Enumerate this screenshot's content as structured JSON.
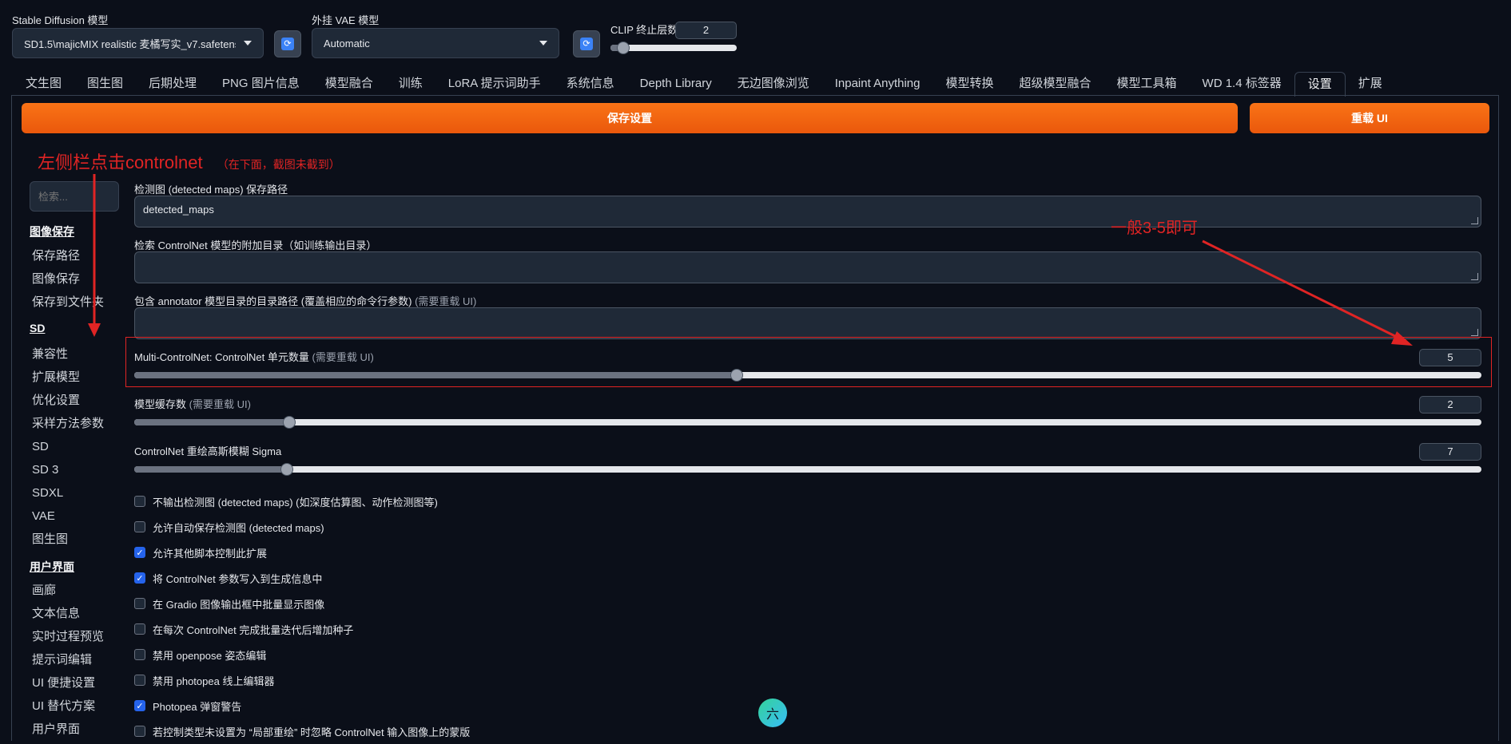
{
  "header": {
    "sd_model_label": "Stable Diffusion 模型",
    "sd_model_value": "SD1.5\\majicMIX realistic 麦橘写实_v7.safetensors",
    "vae_label": "外挂 VAE 模型",
    "vae_value": "Automatic",
    "clip_label": "CLIP 终止层数",
    "clip_value": "2",
    "clip_slider_fraction": 0.1
  },
  "tabs": [
    "文生图",
    "图生图",
    "后期处理",
    "PNG 图片信息",
    "模型融合",
    "训练",
    "LoRA 提示词助手",
    "系统信息",
    "Depth Library",
    "无边图像浏览",
    "Inpaint Anything",
    "模型转换",
    "超级模型融合",
    "模型工具箱",
    "WD 1.4 标签器",
    "设置",
    "扩展"
  ],
  "active_tab": "设置",
  "actions": {
    "save": "保存设置",
    "reload": "重载 UI"
  },
  "sidebar": {
    "search_placeholder": "检索...",
    "group1": "图像保存",
    "group1_items": [
      "保存路径",
      "图像保存",
      "保存到文件夹"
    ],
    "group2": "SD",
    "group2_items": [
      "兼容性",
      "扩展模型",
      "优化设置",
      "采样方法参数",
      "SD",
      "SD 3",
      "SDXL",
      "VAE",
      "图生图"
    ],
    "group3": "用户界面",
    "group3_items": [
      "画廊",
      "文本信息",
      "实时过程预览",
      "提示词编辑",
      "UI 便捷设置",
      "UI 替代方案",
      "用户界面"
    ]
  },
  "settings": {
    "detected_maps_label": "检测图 (detected maps) 保存路径",
    "detected_maps_value": "detected_maps",
    "extra_dir_label": "检索 ControlNet 模型的附加目录（如训练输出目录）",
    "extra_dir_value": "",
    "annotator_label": "包含 annotator 模型目录的目录路径 (覆盖相应的命令行参数)",
    "annotator_note": "(需要重载 UI)",
    "annotator_value": "",
    "multi_label": "Multi-ControlNet: ControlNet 单元数量",
    "multi_note": "(需要重载 UI)",
    "multi_value": "5",
    "multi_fraction": 0.447,
    "cache_label": "模型缓存数",
    "cache_note": "(需要重载 UI)",
    "cache_value": "2",
    "cache_fraction": 0.115,
    "sigma_label": "ControlNet 重绘高斯模糊 Sigma",
    "sigma_value": "7",
    "sigma_fraction": 0.113
  },
  "checkboxes": [
    {
      "label": "不输出检测图 (detected maps) (如深度估算图、动作检测图等)",
      "checked": false
    },
    {
      "label": "允许自动保存检测图 (detected maps)",
      "checked": false
    },
    {
      "label": "允许其他脚本控制此扩展",
      "checked": true
    },
    {
      "label": "将 ControlNet 参数写入到生成信息中",
      "checked": true
    },
    {
      "label": "在 Gradio 图像输出框中批量显示图像",
      "checked": false
    },
    {
      "label": "在每次 ControlNet 完成批量迭代后增加种子",
      "checked": false
    },
    {
      "label": "禁用 openpose 姿态编辑",
      "checked": false
    },
    {
      "label": "禁用 photopea 线上编辑器",
      "checked": false
    },
    {
      "label": "Photopea 弹窗警告",
      "checked": true
    },
    {
      "label": "若控制类型未设置为 “局部重绘” 时忽略 ControlNet 输入图像上的蒙版",
      "checked": false
    }
  ],
  "annotations": {
    "left_note": "左侧栏点击controlnet",
    "left_note_small": "（在下面，截图未截到）",
    "right_note": "一般3-5即可",
    "color": "#e02424"
  },
  "floating_badge": "六"
}
